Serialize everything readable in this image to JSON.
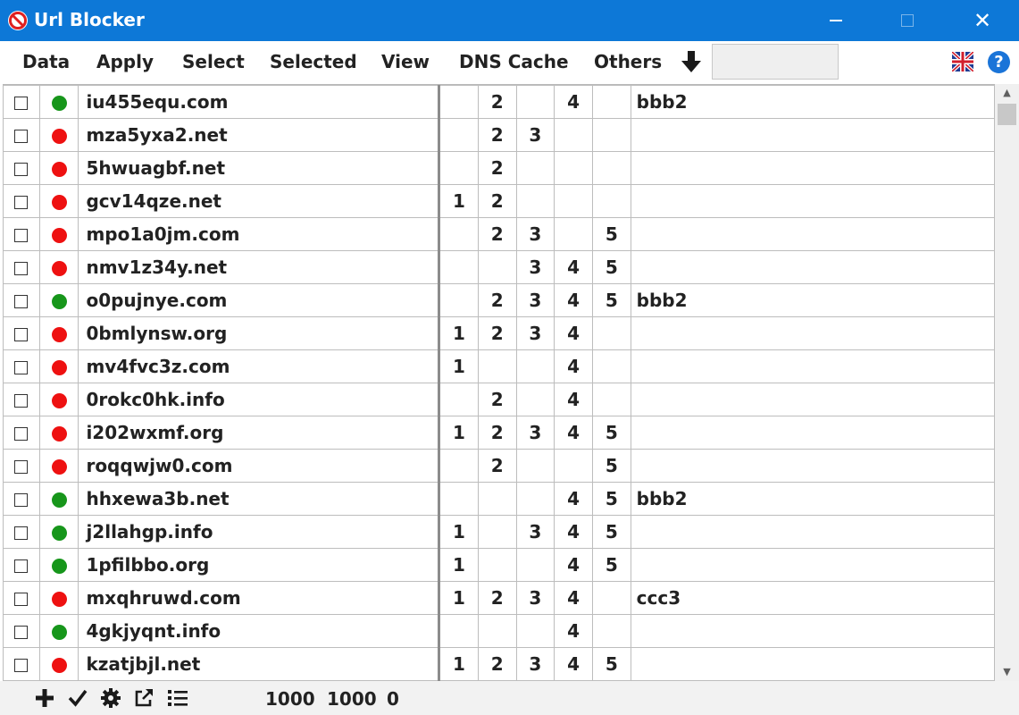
{
  "window": {
    "title": "Url Blocker",
    "icon": "no-entry-icon",
    "controls": [
      "minimize",
      "maximize",
      "close"
    ],
    "close_glyph": "✕"
  },
  "menu": {
    "items": [
      "Data",
      "Apply",
      "Select",
      "Selected",
      "View",
      "DNS Cache",
      "Others"
    ],
    "field_value": "",
    "icons": [
      "down-arrow-icon",
      "uk-flag-icon",
      "help-icon"
    ],
    "help_glyph": "?"
  },
  "colors": {
    "titlebar": "#0d78d7",
    "green": "#17961b",
    "red": "#ee1111"
  },
  "rows": [
    {
      "url": "iu455equ.com",
      "status": "green",
      "c1": "",
      "c2": "2",
      "c3": "",
      "c4": "4",
      "c5": "",
      "tag": "bbb2"
    },
    {
      "url": "mza5yxa2.net",
      "status": "red",
      "c1": "",
      "c2": "2",
      "c3": "3",
      "c4": "",
      "c5": "",
      "tag": ""
    },
    {
      "url": "5hwuagbf.net",
      "status": "red",
      "c1": "",
      "c2": "2",
      "c3": "",
      "c4": "",
      "c5": "",
      "tag": ""
    },
    {
      "url": "gcv14qze.net",
      "status": "red",
      "c1": "1",
      "c2": "2",
      "c3": "",
      "c4": "",
      "c5": "",
      "tag": ""
    },
    {
      "url": "mpo1a0jm.com",
      "status": "red",
      "c1": "",
      "c2": "2",
      "c3": "3",
      "c4": "",
      "c5": "5",
      "tag": ""
    },
    {
      "url": "nmv1z34y.net",
      "status": "red",
      "c1": "",
      "c2": "",
      "c3": "3",
      "c4": "4",
      "c5": "5",
      "tag": ""
    },
    {
      "url": "o0pujnye.com",
      "status": "green",
      "c1": "",
      "c2": "2",
      "c3": "3",
      "c4": "4",
      "c5": "5",
      "tag": "bbb2"
    },
    {
      "url": "0bmlynsw.org",
      "status": "red",
      "c1": "1",
      "c2": "2",
      "c3": "3",
      "c4": "4",
      "c5": "",
      "tag": ""
    },
    {
      "url": "mv4fvc3z.com",
      "status": "red",
      "c1": "1",
      "c2": "",
      "c3": "",
      "c4": "4",
      "c5": "",
      "tag": ""
    },
    {
      "url": "0rokc0hk.info",
      "status": "red",
      "c1": "",
      "c2": "2",
      "c3": "",
      "c4": "4",
      "c5": "",
      "tag": ""
    },
    {
      "url": "i202wxmf.org",
      "status": "red",
      "c1": "1",
      "c2": "2",
      "c3": "3",
      "c4": "4",
      "c5": "5",
      "tag": ""
    },
    {
      "url": "roqqwjw0.com",
      "status": "red",
      "c1": "",
      "c2": "2",
      "c3": "",
      "c4": "",
      "c5": "5",
      "tag": ""
    },
    {
      "url": "hhxewa3b.net",
      "status": "green",
      "c1": "",
      "c2": "",
      "c3": "",
      "c4": "4",
      "c5": "5",
      "tag": "bbb2"
    },
    {
      "url": "j2llahgp.info",
      "status": "green",
      "c1": "1",
      "c2": "",
      "c3": "3",
      "c4": "4",
      "c5": "5",
      "tag": ""
    },
    {
      "url": "1pfilbbo.org",
      "status": "green",
      "c1": "1",
      "c2": "",
      "c3": "",
      "c4": "4",
      "c5": "5",
      "tag": ""
    },
    {
      "url": "mxqhruwd.com",
      "status": "red",
      "c1": "1",
      "c2": "2",
      "c3": "3",
      "c4": "4",
      "c5": "",
      "tag": "ccc3"
    },
    {
      "url": "4gkjyqnt.info",
      "status": "green",
      "c1": "",
      "c2": "",
      "c3": "",
      "c4": "4",
      "c5": "",
      "tag": ""
    },
    {
      "url": "kzatjbjl.net",
      "status": "red",
      "c1": "1",
      "c2": "2",
      "c3": "3",
      "c4": "4",
      "c5": "5",
      "tag": ""
    }
  ],
  "scrollbar": {
    "up_glyph": "▲",
    "down_glyph": "▼"
  },
  "statusbar": {
    "icons": [
      "plus-icon",
      "checkmark-icon",
      "gear-icon",
      "external-link-icon",
      "list-icon"
    ],
    "counts": [
      "1000",
      "1000",
      "0"
    ]
  }
}
